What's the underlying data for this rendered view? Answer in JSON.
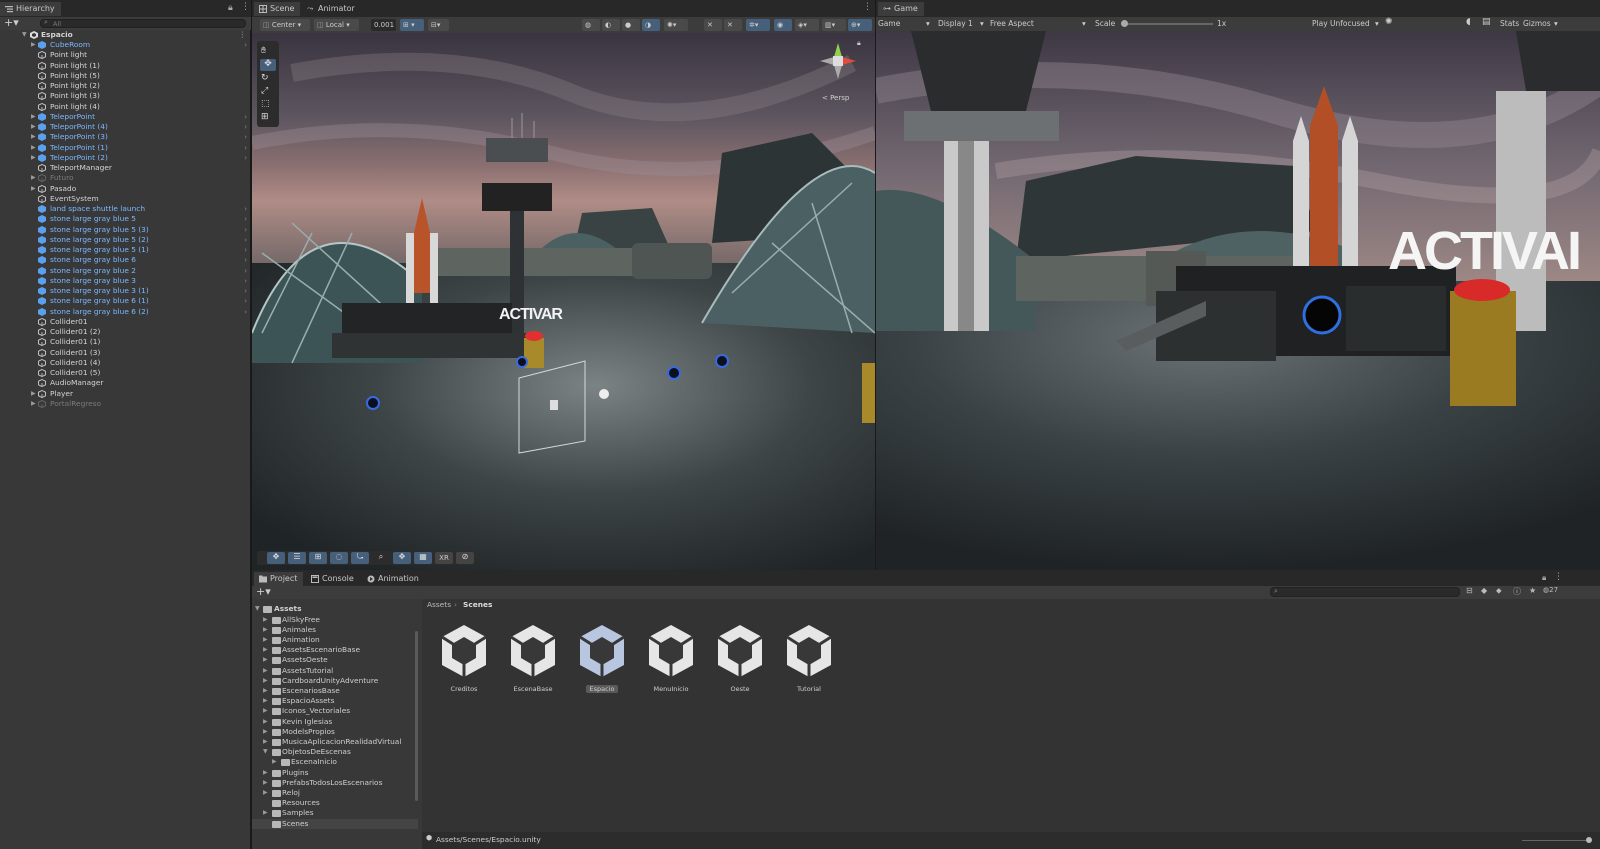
{
  "hierarchy": {
    "tab_label": "Hierarchy",
    "search_placeholder": "All",
    "scene_name": "Espacio",
    "items": [
      {
        "label": "CubeRoom",
        "type": "prefab",
        "expand": true,
        "chev": true
      },
      {
        "label": "Point light",
        "type": "obj"
      },
      {
        "label": "Point light (1)",
        "type": "obj"
      },
      {
        "label": "Point light (5)",
        "type": "obj"
      },
      {
        "label": "Point light (2)",
        "type": "obj"
      },
      {
        "label": "Point light (3)",
        "type": "obj"
      },
      {
        "label": "Point light (4)",
        "type": "obj"
      },
      {
        "label": "TeleporPoint",
        "type": "prefab",
        "expand": true,
        "chev": true
      },
      {
        "label": "TeleporPoint (4)",
        "type": "prefab",
        "expand": true,
        "chev": true
      },
      {
        "label": "TeleporPoint (3)",
        "type": "prefab",
        "expand": true,
        "chev": true
      },
      {
        "label": "TeleporPoint (1)",
        "type": "prefab",
        "expand": true,
        "chev": true
      },
      {
        "label": "TeleporPoint (2)",
        "type": "prefab",
        "expand": true,
        "chev": true
      },
      {
        "label": "TeleportManager",
        "type": "obj"
      },
      {
        "label": "Futuro",
        "type": "disabled",
        "expand": true
      },
      {
        "label": "Pasado",
        "type": "obj",
        "expand": true
      },
      {
        "label": "EventSystem",
        "type": "obj"
      },
      {
        "label": "land space shuttle launch",
        "type": "prefab",
        "chev": true
      },
      {
        "label": "stone large gray blue 5",
        "type": "prefab",
        "chev": true
      },
      {
        "label": "stone large gray blue 5 (3)",
        "type": "prefab",
        "chev": true
      },
      {
        "label": "stone large gray blue 5 (2)",
        "type": "prefab",
        "chev": true
      },
      {
        "label": "stone large gray blue 5 (1)",
        "type": "prefab",
        "chev": true
      },
      {
        "label": "stone large gray blue 6",
        "type": "prefab",
        "chev": true
      },
      {
        "label": "stone large gray blue 2",
        "type": "prefab",
        "chev": true
      },
      {
        "label": "stone large gray blue 3",
        "type": "prefab",
        "chev": true
      },
      {
        "label": "stone large gray blue 3 (1)",
        "type": "prefab",
        "chev": true
      },
      {
        "label": "stone large gray blue 6 (1)",
        "type": "prefab",
        "chev": true
      },
      {
        "label": "stone large gray blue 6 (2)",
        "type": "prefab",
        "chev": true
      },
      {
        "label": "Collider01",
        "type": "obj"
      },
      {
        "label": "Collider01 (2)",
        "type": "obj"
      },
      {
        "label": "Collider01 (1)",
        "type": "obj"
      },
      {
        "label": "Collider01 (3)",
        "type": "obj"
      },
      {
        "label": "Collider01 (4)",
        "type": "obj"
      },
      {
        "label": "Collider01 (5)",
        "type": "obj"
      },
      {
        "label": "AudioManager",
        "type": "obj"
      },
      {
        "label": "Player",
        "type": "obj",
        "expand": true
      },
      {
        "label": "PortalRegreso",
        "type": "disabled",
        "expand": true
      }
    ]
  },
  "scene": {
    "tab_scene": "Scene",
    "tab_animator": "Animator",
    "pivot": "Center",
    "space": "Local",
    "snap": "0.001",
    "persp": "< Persp",
    "activar_text": "ACTIVAR",
    "overlay_xr": "XR"
  },
  "game": {
    "tab": "Game",
    "mode": "Game",
    "display": "Display 1",
    "aspect": "Free Aspect",
    "scale_label": "Scale",
    "scale_value": "1x",
    "play_mode": "Play Unfocused",
    "stats": "Stats",
    "gizmos": "Gizmos",
    "activar_text": "ACTIVAI"
  },
  "project": {
    "tabs": [
      "Project",
      "Console",
      "Animation"
    ],
    "breadcrumb": [
      "Assets",
      "Scenes"
    ],
    "root": "Assets",
    "folders": [
      {
        "label": "AllSkyFree",
        "depth": 1,
        "arrow": "▶"
      },
      {
        "label": "Animales",
        "depth": 1,
        "arrow": "▶"
      },
      {
        "label": "Animation",
        "depth": 1,
        "arrow": "▶"
      },
      {
        "label": "AssetsEscenarioBase",
        "depth": 1,
        "arrow": "▶"
      },
      {
        "label": "AssetsOeste",
        "depth": 1,
        "arrow": "▶"
      },
      {
        "label": "AssetsTutorial",
        "depth": 1,
        "arrow": "▶"
      },
      {
        "label": "CardboardUnityAdventure",
        "depth": 1,
        "arrow": "▶"
      },
      {
        "label": "EscenariosBase",
        "depth": 1,
        "arrow": "▶"
      },
      {
        "label": "EspacioAssets",
        "depth": 1,
        "arrow": "▶"
      },
      {
        "label": "Iconos_Vectoriales",
        "depth": 1,
        "arrow": "▶"
      },
      {
        "label": "Kevin Iglesias",
        "depth": 1,
        "arrow": "▶"
      },
      {
        "label": "ModelsPropios",
        "depth": 1,
        "arrow": "▶"
      },
      {
        "label": "MusicaAplicacionRealidadVirtual",
        "depth": 1,
        "arrow": "▶"
      },
      {
        "label": "ObjetosDeEscenas",
        "depth": 1,
        "arrow": "▼"
      },
      {
        "label": "EscenaInicio",
        "depth": 2,
        "arrow": "▶"
      },
      {
        "label": "Plugins",
        "depth": 1,
        "arrow": "▶"
      },
      {
        "label": "PrefabsTodosLosEscenarios",
        "depth": 1,
        "arrow": "▶"
      },
      {
        "label": "Reloj",
        "depth": 1,
        "arrow": "▶"
      },
      {
        "label": "Resources",
        "depth": 1,
        "arrow": ""
      },
      {
        "label": "Samples",
        "depth": 1,
        "arrow": "▶"
      },
      {
        "label": "Scenes",
        "depth": 1,
        "arrow": "",
        "selected": true
      }
    ],
    "assets": [
      {
        "label": "Creditos"
      },
      {
        "label": "EscenaBase"
      },
      {
        "label": "Espacio",
        "selected": true
      },
      {
        "label": "MenuInicio"
      },
      {
        "label": "Oeste"
      },
      {
        "label": "Tutorial"
      }
    ],
    "path": "Assets/Scenes/Espacio.unity",
    "count": "27"
  }
}
